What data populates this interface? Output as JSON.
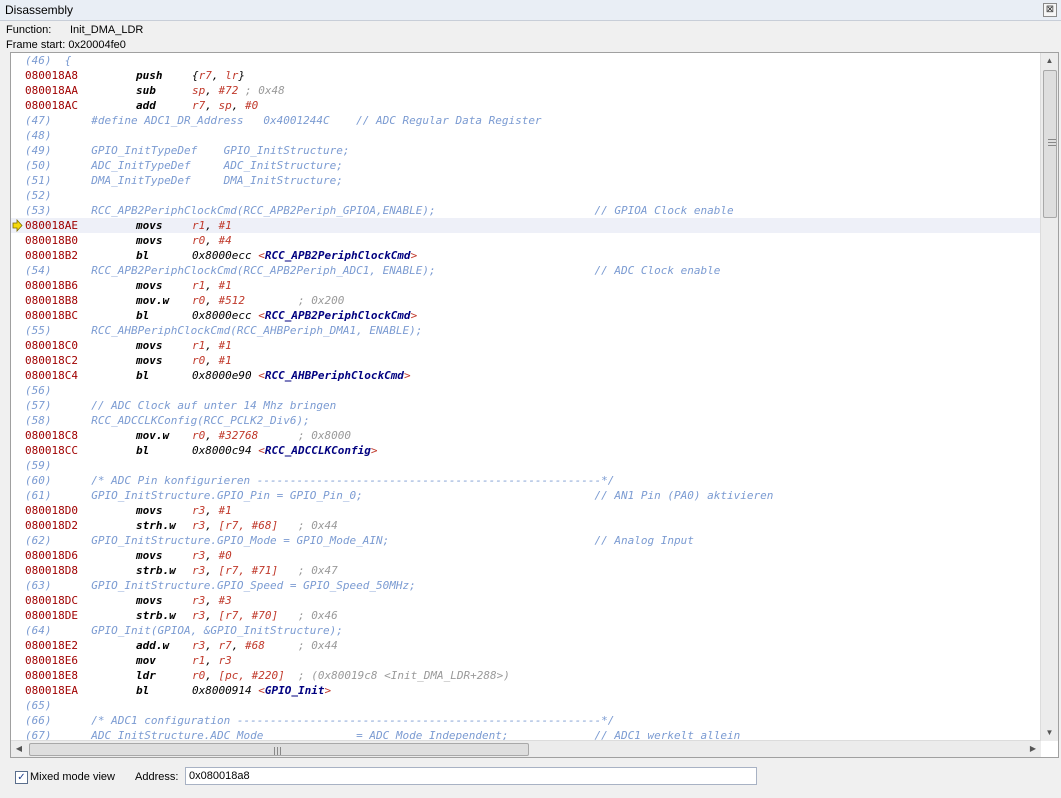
{
  "window": {
    "title": "Disassembly",
    "close_glyph": "⊠"
  },
  "info": {
    "function_label": "Function:",
    "function_value": "Init_DMA_LDR",
    "frame_label": "Frame start:",
    "frame_value": "0x20004fe0"
  },
  "colors": {
    "address": "#a00000",
    "source": "#7b9bd2",
    "register": "#c0392b",
    "comment": "#9a9a9a",
    "symbol": "#000080",
    "current_line": "#eef0f8",
    "arrow": "#f5d90a"
  },
  "current_line_icon": "current-instruction-arrow-icon",
  "lines": [
    {
      "type": "src",
      "text": "(46)  {"
    },
    {
      "type": "asm",
      "addr": "080018A8",
      "mn": "push",
      "ops": [
        [
          "t",
          "{"
        ],
        [
          "r",
          "r7"
        ],
        [
          "t",
          ", "
        ],
        [
          "r",
          "lr"
        ],
        [
          "t",
          "}"
        ]
      ]
    },
    {
      "type": "asm",
      "addr": "080018AA",
      "mn": "sub",
      "ops": [
        [
          "r",
          "sp"
        ],
        [
          "t",
          ", "
        ],
        [
          "r",
          "#72"
        ],
        [
          "c",
          " ; 0x48"
        ]
      ]
    },
    {
      "type": "asm",
      "addr": "080018AC",
      "mn": "add",
      "ops": [
        [
          "r",
          "r7"
        ],
        [
          "t",
          ", "
        ],
        [
          "r",
          "sp"
        ],
        [
          "t",
          ", "
        ],
        [
          "r",
          "#0"
        ]
      ]
    },
    {
      "type": "src",
      "text": "(47)      #define ADC1_DR_Address   0x4001244C    // ADC Regular Data Register"
    },
    {
      "type": "src",
      "text": "(48)"
    },
    {
      "type": "src",
      "text": "(49)      GPIO_InitTypeDef    GPIO_InitStructure;"
    },
    {
      "type": "src",
      "text": "(50)      ADC_InitTypeDef     ADC_InitStructure;"
    },
    {
      "type": "src",
      "text": "(51)      DMA_InitTypeDef     DMA_InitStructure;"
    },
    {
      "type": "src",
      "text": "(52)"
    },
    {
      "type": "src",
      "text": "(53)      RCC_APB2PeriphClockCmd(RCC_APB2Periph_GPIOA,ENABLE);                        // GPIOA Clock enable"
    },
    {
      "type": "asm",
      "addr": "080018AE",
      "mn": "movs",
      "current": true,
      "ops": [
        [
          "r",
          "r1"
        ],
        [
          "t",
          ", "
        ],
        [
          "r",
          "#1"
        ]
      ]
    },
    {
      "type": "asm",
      "addr": "080018B0",
      "mn": "movs",
      "ops": [
        [
          "r",
          "r0"
        ],
        [
          "t",
          ", "
        ],
        [
          "r",
          "#4"
        ]
      ]
    },
    {
      "type": "asm",
      "addr": "080018B2",
      "mn": "bl",
      "ops": [
        [
          "t",
          "0x8000ecc "
        ],
        [
          "r",
          "<"
        ],
        [
          "s",
          "RCC_APB2PeriphClockCmd"
        ],
        [
          "r",
          ">"
        ]
      ]
    },
    {
      "type": "src",
      "text": "(54)      RCC_APB2PeriphClockCmd(RCC_APB2Periph_ADC1, ENABLE);                        // ADC Clock enable"
    },
    {
      "type": "asm",
      "addr": "080018B6",
      "mn": "movs",
      "ops": [
        [
          "r",
          "r1"
        ],
        [
          "t",
          ", "
        ],
        [
          "r",
          "#1"
        ]
      ]
    },
    {
      "type": "asm",
      "addr": "080018B8",
      "mn": "mov.w",
      "ops": [
        [
          "r",
          "r0"
        ],
        [
          "t",
          ", "
        ],
        [
          "r",
          "#512"
        ],
        [
          "c",
          "        ; 0x200"
        ]
      ]
    },
    {
      "type": "asm",
      "addr": "080018BC",
      "mn": "bl",
      "ops": [
        [
          "t",
          "0x8000ecc "
        ],
        [
          "r",
          "<"
        ],
        [
          "s",
          "RCC_APB2PeriphClockCmd"
        ],
        [
          "r",
          ">"
        ]
      ]
    },
    {
      "type": "src",
      "text": "(55)      RCC_AHBPeriphClockCmd(RCC_AHBPeriph_DMA1, ENABLE);"
    },
    {
      "type": "asm",
      "addr": "080018C0",
      "mn": "movs",
      "ops": [
        [
          "r",
          "r1"
        ],
        [
          "t",
          ", "
        ],
        [
          "r",
          "#1"
        ]
      ]
    },
    {
      "type": "asm",
      "addr": "080018C2",
      "mn": "movs",
      "ops": [
        [
          "r",
          "r0"
        ],
        [
          "t",
          ", "
        ],
        [
          "r",
          "#1"
        ]
      ]
    },
    {
      "type": "asm",
      "addr": "080018C4",
      "mn": "bl",
      "ops": [
        [
          "t",
          "0x8000e90 "
        ],
        [
          "r",
          "<"
        ],
        [
          "s",
          "RCC_AHBPeriphClockCmd"
        ],
        [
          "r",
          ">"
        ]
      ]
    },
    {
      "type": "src",
      "text": "(56)"
    },
    {
      "type": "src",
      "text": "(57)      // ADC Clock auf unter 14 Mhz bringen"
    },
    {
      "type": "src",
      "text": "(58)      RCC_ADCCLKConfig(RCC_PCLK2_Div6);"
    },
    {
      "type": "asm",
      "addr": "080018C8",
      "mn": "mov.w",
      "ops": [
        [
          "r",
          "r0"
        ],
        [
          "t",
          ", "
        ],
        [
          "r",
          "#32768"
        ],
        [
          "c",
          "      ; 0x8000"
        ]
      ]
    },
    {
      "type": "asm",
      "addr": "080018CC",
      "mn": "bl",
      "ops": [
        [
          "t",
          "0x8000c94 "
        ],
        [
          "r",
          "<"
        ],
        [
          "s",
          "RCC_ADCCLKConfig"
        ],
        [
          "r",
          ">"
        ]
      ]
    },
    {
      "type": "src",
      "text": "(59)"
    },
    {
      "type": "src",
      "text": "(60)      /* ADC Pin konfigurieren ----------------------------------------------------*/"
    },
    {
      "type": "src",
      "text": "(61)      GPIO_InitStructure.GPIO_Pin = GPIO_Pin_0;                                   // AN1 Pin (PA0) aktivieren"
    },
    {
      "type": "asm",
      "addr": "080018D0",
      "mn": "movs",
      "ops": [
        [
          "r",
          "r3"
        ],
        [
          "t",
          ", "
        ],
        [
          "r",
          "#1"
        ]
      ]
    },
    {
      "type": "asm",
      "addr": "080018D2",
      "mn": "strh.w",
      "ops": [
        [
          "r",
          "r3"
        ],
        [
          "t",
          ", "
        ],
        [
          "r",
          "[r7, #68]"
        ],
        [
          "c",
          "   ; 0x44"
        ]
      ]
    },
    {
      "type": "src",
      "text": "(62)      GPIO_InitStructure.GPIO_Mode = GPIO_Mode_AIN;                               // Analog Input"
    },
    {
      "type": "asm",
      "addr": "080018D6",
      "mn": "movs",
      "ops": [
        [
          "r",
          "r3"
        ],
        [
          "t",
          ", "
        ],
        [
          "r",
          "#0"
        ]
      ]
    },
    {
      "type": "asm",
      "addr": "080018D8",
      "mn": "strb.w",
      "ops": [
        [
          "r",
          "r3"
        ],
        [
          "t",
          ", "
        ],
        [
          "r",
          "[r7, #71]"
        ],
        [
          "c",
          "   ; 0x47"
        ]
      ]
    },
    {
      "type": "src",
      "text": "(63)      GPIO_InitStructure.GPIO_Speed = GPIO_Speed_50MHz;"
    },
    {
      "type": "asm",
      "addr": "080018DC",
      "mn": "movs",
      "ops": [
        [
          "r",
          "r3"
        ],
        [
          "t",
          ", "
        ],
        [
          "r",
          "#3"
        ]
      ]
    },
    {
      "type": "asm",
      "addr": "080018DE",
      "mn": "strb.w",
      "ops": [
        [
          "r",
          "r3"
        ],
        [
          "t",
          ", "
        ],
        [
          "r",
          "[r7, #70]"
        ],
        [
          "c",
          "   ; 0x46"
        ]
      ]
    },
    {
      "type": "src",
      "text": "(64)      GPIO_Init(GPIOA, &GPIO_InitStructure);"
    },
    {
      "type": "asm",
      "addr": "080018E2",
      "mn": "add.w",
      "ops": [
        [
          "r",
          "r3"
        ],
        [
          "t",
          ", "
        ],
        [
          "r",
          "r7"
        ],
        [
          "t",
          ", "
        ],
        [
          "r",
          "#68"
        ],
        [
          "c",
          "     ; 0x44"
        ]
      ]
    },
    {
      "type": "asm",
      "addr": "080018E6",
      "mn": "mov",
      "ops": [
        [
          "r",
          "r1"
        ],
        [
          "t",
          ", "
        ],
        [
          "r",
          "r3"
        ]
      ]
    },
    {
      "type": "asm",
      "addr": "080018E8",
      "mn": "ldr",
      "ops": [
        [
          "r",
          "r0"
        ],
        [
          "t",
          ", "
        ],
        [
          "r",
          "[pc, #220]"
        ],
        [
          "c",
          "  ; (0x80019c8 <Init_DMA_LDR+288>)"
        ]
      ]
    },
    {
      "type": "asm",
      "addr": "080018EA",
      "mn": "bl",
      "ops": [
        [
          "t",
          "0x8000914 "
        ],
        [
          "r",
          "<"
        ],
        [
          "s",
          "GPIO_Init"
        ],
        [
          "r",
          ">"
        ]
      ]
    },
    {
      "type": "src",
      "text": "(65)"
    },
    {
      "type": "src",
      "text": "(66)      /* ADC1 configuration -------------------------------------------------------*/"
    },
    {
      "type": "src",
      "text": "(67)      ADC_InitStructure.ADC_Mode              = ADC_Mode_Independent;             // ADC1 werkelt allein"
    }
  ],
  "bottom": {
    "mixed_mode_checked": "✓",
    "mixed_mode_label": "Mixed mode view",
    "address_label": "Address:",
    "address_value": "0x080018a8"
  },
  "scroll": {
    "up_glyph": "▲",
    "down_glyph": "▼",
    "left_glyph": "◀",
    "right_glyph": "▶"
  }
}
